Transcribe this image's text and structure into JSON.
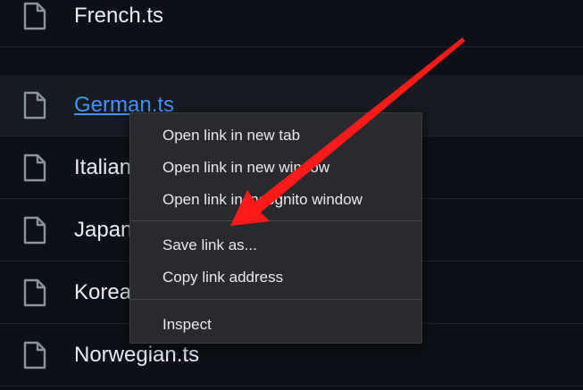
{
  "files": [
    {
      "name": "French.ts"
    },
    {
      "name": "German.ts"
    },
    {
      "name": "Italian.ts"
    },
    {
      "name": "Japanese.ts"
    },
    {
      "name": "Korean.ts"
    },
    {
      "name": "Norwegian.ts"
    }
  ],
  "context_menu": {
    "items": [
      {
        "label": "Open link in new tab"
      },
      {
        "label": "Open link in new window"
      },
      {
        "label": "Open link in incognito window"
      },
      {
        "label": "Save link as..."
      },
      {
        "label": "Copy link address"
      },
      {
        "label": "Inspect"
      }
    ]
  },
  "colors": {
    "background": "#0d1117",
    "link": "#4493f8",
    "arrow": "#ff1a1a",
    "menu_bg": "#292a2d"
  }
}
